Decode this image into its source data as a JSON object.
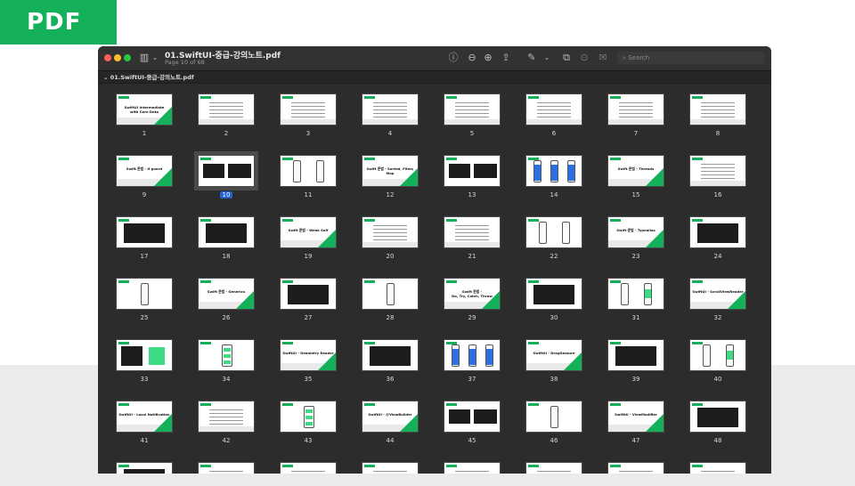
{
  "badge": {
    "label": "PDF"
  },
  "window": {
    "title": "01.SwiftUI-중급-강의노트.pdf",
    "subtitle": "Page 10 of 68",
    "sidebar_title": "01.SwiftUI-중급-강의노트.pdf",
    "search_placeholder": "Search",
    "selected_page": 10
  },
  "thumbnails": [
    {
      "n": "1",
      "kind": "title",
      "text": "SwiftUI Intermediate\nwith Core Data"
    },
    {
      "n": "2",
      "kind": "text"
    },
    {
      "n": "3",
      "kind": "text"
    },
    {
      "n": "4",
      "kind": "text"
    },
    {
      "n": "5",
      "kind": "text"
    },
    {
      "n": "6",
      "kind": "text"
    },
    {
      "n": "7",
      "kind": "text"
    },
    {
      "n": "8",
      "kind": "text"
    },
    {
      "n": "9",
      "kind": "title",
      "text": "Swift 문법 - if guard"
    },
    {
      "n": "10",
      "kind": "dark2"
    },
    {
      "n": "11",
      "kind": "phones"
    },
    {
      "n": "12",
      "kind": "title",
      "text": "Swift 문법 - Sorted, Filter, Map"
    },
    {
      "n": "13",
      "kind": "dark2"
    },
    {
      "n": "14",
      "kind": "phones-blue"
    },
    {
      "n": "15",
      "kind": "title",
      "text": "Swift 문법 - Threads"
    },
    {
      "n": "16",
      "kind": "text"
    },
    {
      "n": "17",
      "kind": "dark"
    },
    {
      "n": "18",
      "kind": "dark"
    },
    {
      "n": "19",
      "kind": "title",
      "text": "Swift 문법 - Weak Self"
    },
    {
      "n": "20",
      "kind": "text"
    },
    {
      "n": "21",
      "kind": "text"
    },
    {
      "n": "22",
      "kind": "phones"
    },
    {
      "n": "23",
      "kind": "title",
      "text": "Swift 문법 - Typealias"
    },
    {
      "n": "24",
      "kind": "dark"
    },
    {
      "n": "25",
      "kind": "phone1"
    },
    {
      "n": "26",
      "kind": "title",
      "text": "Swift 문법 - Generics"
    },
    {
      "n": "27",
      "kind": "dark"
    },
    {
      "n": "28",
      "kind": "phone1"
    },
    {
      "n": "29",
      "kind": "title",
      "text": "Swift 문법 -\nDo, Try, Catch, Throw"
    },
    {
      "n": "30",
      "kind": "dark"
    },
    {
      "n": "31",
      "kind": "phones-green"
    },
    {
      "n": "32",
      "kind": "title",
      "text": "SwiftUI - ScrollViewReader"
    },
    {
      "n": "33",
      "kind": "dark-green"
    },
    {
      "n": "34",
      "kind": "phone-green"
    },
    {
      "n": "35",
      "kind": "title",
      "text": "SwiftUI - Geometry Reader"
    },
    {
      "n": "36",
      "kind": "dark"
    },
    {
      "n": "37",
      "kind": "phones-blue"
    },
    {
      "n": "38",
      "kind": "title",
      "text": "SwiftUI - DragGesture"
    },
    {
      "n": "39",
      "kind": "dark"
    },
    {
      "n": "40",
      "kind": "phones-green"
    },
    {
      "n": "41",
      "kind": "title",
      "text": "SwiftUI - Local Notification"
    },
    {
      "n": "42",
      "kind": "text"
    },
    {
      "n": "43",
      "kind": "phone-green"
    },
    {
      "n": "44",
      "kind": "title",
      "text": "SwiftUI - @ViewBuilder"
    },
    {
      "n": "45",
      "kind": "dark2"
    },
    {
      "n": "46",
      "kind": "phone1"
    },
    {
      "n": "47",
      "kind": "title",
      "text": "SwiftUI - ViewModifier"
    },
    {
      "n": "48",
      "kind": "dark"
    },
    {
      "n": "",
      "kind": "dark"
    },
    {
      "n": "",
      "kind": "text"
    },
    {
      "n": "",
      "kind": "text"
    },
    {
      "n": "",
      "kind": "text"
    },
    {
      "n": "",
      "kind": "text"
    },
    {
      "n": "",
      "kind": "text"
    },
    {
      "n": "",
      "kind": "text"
    },
    {
      "n": "",
      "kind": "text"
    }
  ],
  "colors": {
    "accent": "#14b05a",
    "selection": "#2563d0",
    "window": "#2c2c2c"
  },
  "toolbar_icons": [
    "sidebar-icon",
    "chevron-down-icon",
    "info-icon",
    "zoom-out-icon",
    "zoom-in-icon",
    "share-icon",
    "markup-pen-icon",
    "chevron-down-icon",
    "rotate-icon",
    "annotate-icon",
    "form-icon",
    "search-icon"
  ]
}
